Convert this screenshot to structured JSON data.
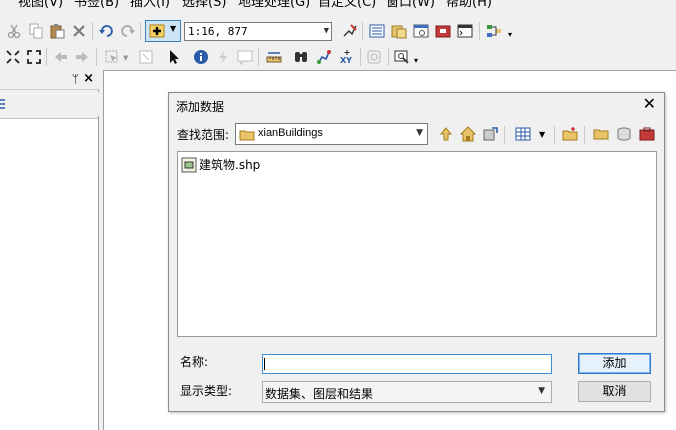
{
  "menu": [
    "视图(V)",
    "书签(B)",
    "插入(I)",
    "选择(S)",
    "地理处理(G)",
    "自定义(C)",
    "窗口(W)",
    "帮助(H)"
  ],
  "toolbar": {
    "scale_value": "1:16, 877"
  },
  "dock": {
    "pin": "ᛘ",
    "close": "×"
  },
  "dialog": {
    "title": "添加数据",
    "close": "✕",
    "look_in_label": "查找范围:",
    "look_in_value": "xianBuildings",
    "files": [
      {
        "name": "建筑物.shp",
        "icon": "shapefile-polygon-icon"
      }
    ],
    "name_label": "名称:",
    "name_value": "",
    "type_label": "显示类型:",
    "type_value": "数据集、图层和结果",
    "add_button": "添加",
    "cancel_button": "取消"
  },
  "colors": {
    "accent_blue": "#3c8fd6",
    "folder_yellow": "#e8c36a"
  }
}
